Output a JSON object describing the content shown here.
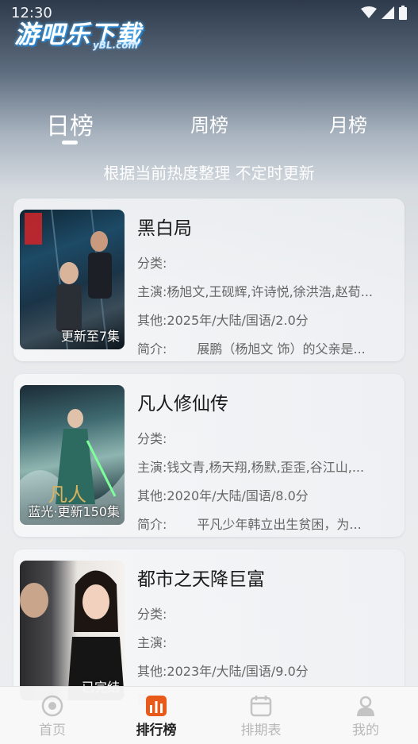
{
  "status": {
    "time": "12:30"
  },
  "logo": {
    "main": "游吧乐下载",
    "sub": "yBL.com"
  },
  "tabs": [
    {
      "label": "日榜"
    },
    {
      "label": "周榜"
    },
    {
      "label": "月榜"
    }
  ],
  "subtitle": "根据当前热度整理 不定时更新",
  "labels": {
    "category": "分类:",
    "cast": "主演:",
    "other": "其他:",
    "intro": "简介:"
  },
  "items": [
    {
      "title": "黑白局",
      "category": "",
      "cast": "杨旭文,王砚辉,许诗悦,徐洪浩,赵荀...",
      "other": "2025年/大陆/国语/2.0分",
      "intro": "展鹏（杨旭文 饰）的父亲是...",
      "badge": "更新至7集"
    },
    {
      "title": "凡人修仙传",
      "category": "",
      "cast": "钱文青,杨天翔,杨默,歪歪,谷江山,...",
      "other": "2020年/大陆/国语/8.0分",
      "intro": "平凡少年韩立出生贫困，为...",
      "badge": "蓝光·更新150集"
    },
    {
      "title": "都市之天降巨富",
      "category": "",
      "cast": "",
      "other": "2023年/大陆/国语/9.0分",
      "intro": "",
      "badge": "已完结"
    }
  ],
  "nav": [
    {
      "label": "首页"
    },
    {
      "label": "排行榜"
    },
    {
      "label": "排期表"
    },
    {
      "label": "我的"
    }
  ],
  "colors": {
    "accent": "#e8591a",
    "nav_inactive": "#b8b8b8"
  }
}
